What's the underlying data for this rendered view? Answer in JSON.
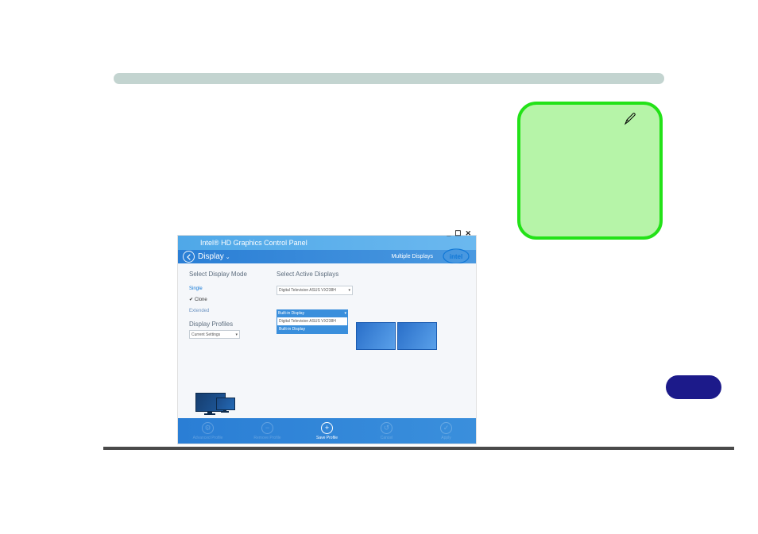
{
  "panel": {
    "title": "Intel® HD Graphics Control Panel",
    "section": "Display",
    "subtitle": "Multiple Displays",
    "brand": "intel",
    "window_controls": {
      "min": "_",
      "max": "☐",
      "close": "✕"
    },
    "select_display_mode_label": "Select Display Mode",
    "select_active_displays_label": "Select Active Displays",
    "display_profiles_label": "Display Profiles",
    "modes": {
      "single": "Single",
      "clone": "Clone",
      "extended": "Extended"
    },
    "profile_selected": "Current Settings",
    "active_display_1": "Digital Television ASUS VX238H",
    "dropdown": {
      "header": "Built-in Display",
      "item1": "Digital Television ASUS VX238H",
      "item2": "Built-in Display"
    },
    "bottom": {
      "advanced": "Advanced Profile",
      "remove": "Remove Profile",
      "save": "Save Profile",
      "cancel": "Cancel",
      "apply": "Apply"
    }
  }
}
